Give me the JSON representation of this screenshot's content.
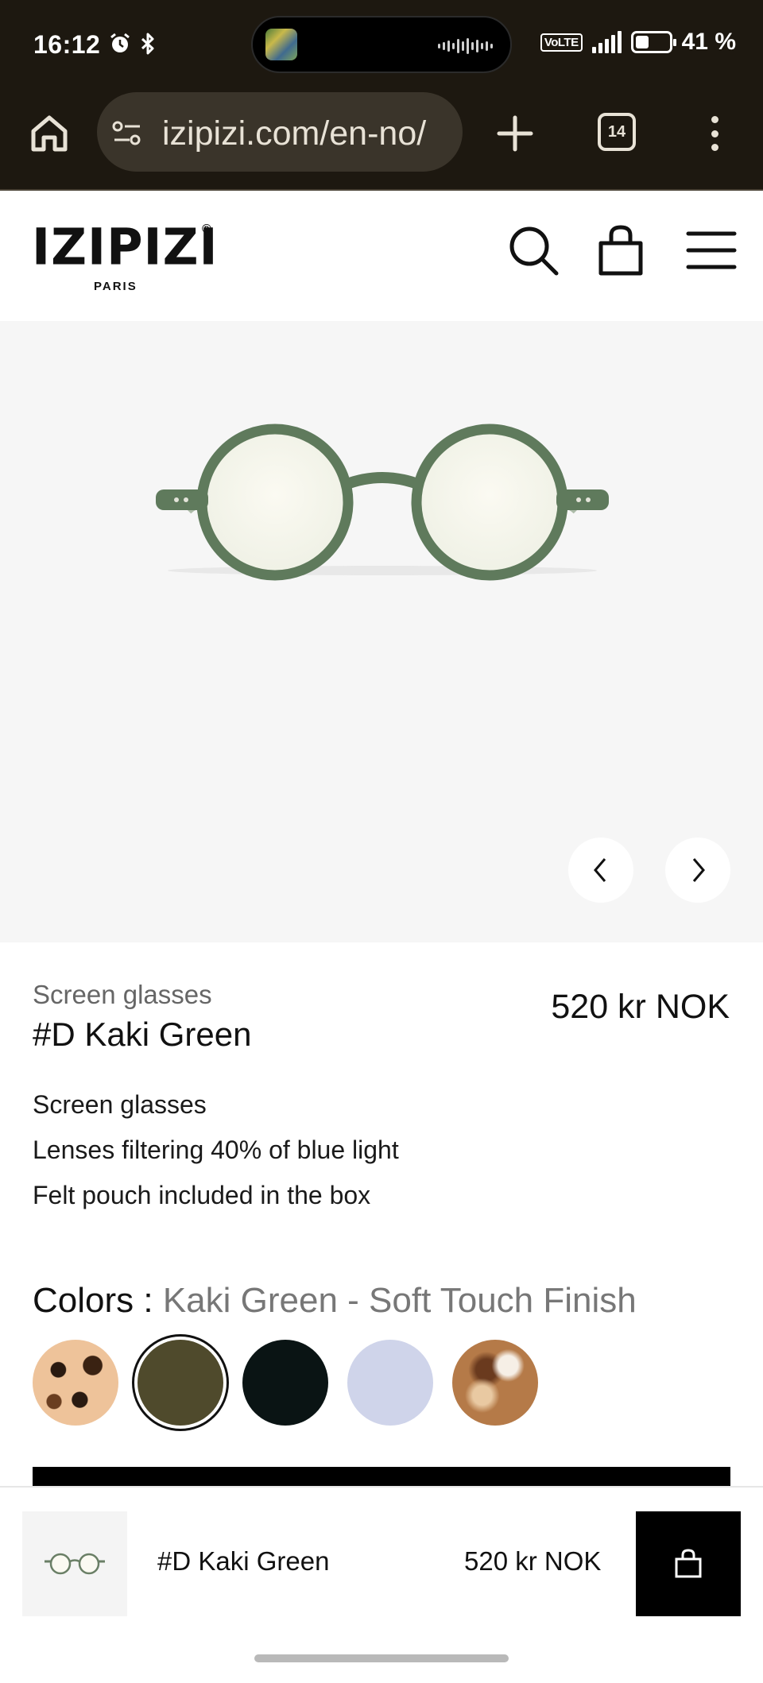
{
  "status_bar": {
    "time": "16:12",
    "network": "VoLTE",
    "battery": "41 %",
    "battery_level": 0.41,
    "icons": [
      "alarm-icon",
      "bluetooth-icon",
      "signal-icon",
      "battery-icon"
    ]
  },
  "browser": {
    "url": "izipizi.com/en-no/",
    "tab_count": "14"
  },
  "site": {
    "logo": "IZIPIZI",
    "logo_sub": "PARIS",
    "header_icons": [
      "search-icon",
      "bag-icon",
      "hamburger-menu-icon"
    ]
  },
  "gallery": {
    "prev_icon": "chevron-left-icon",
    "next_icon": "chevron-right-icon"
  },
  "product": {
    "category": "Screen glasses",
    "title": "#D Kaki Green",
    "price": "520 kr NOK",
    "features": [
      "Screen glasses",
      "Lenses filtering 40% of blue light",
      "Felt pouch included in the box"
    ],
    "colors_label": "Colors :",
    "selected_color": "Kaki Green - Soft Touch Finish",
    "swatches": [
      {
        "name": "tortoise",
        "color": "#e9b98d"
      },
      {
        "name": "kaki-green",
        "color": "#4f4a2c"
      },
      {
        "name": "black",
        "color": "#0a1414"
      },
      {
        "name": "lavender",
        "color": "#cfd4ea"
      },
      {
        "name": "brown-tortoise",
        "color": "#b57a48"
      }
    ]
  },
  "sticky_bar": {
    "title": "#D Kaki Green",
    "price": "520 kr NOK"
  }
}
